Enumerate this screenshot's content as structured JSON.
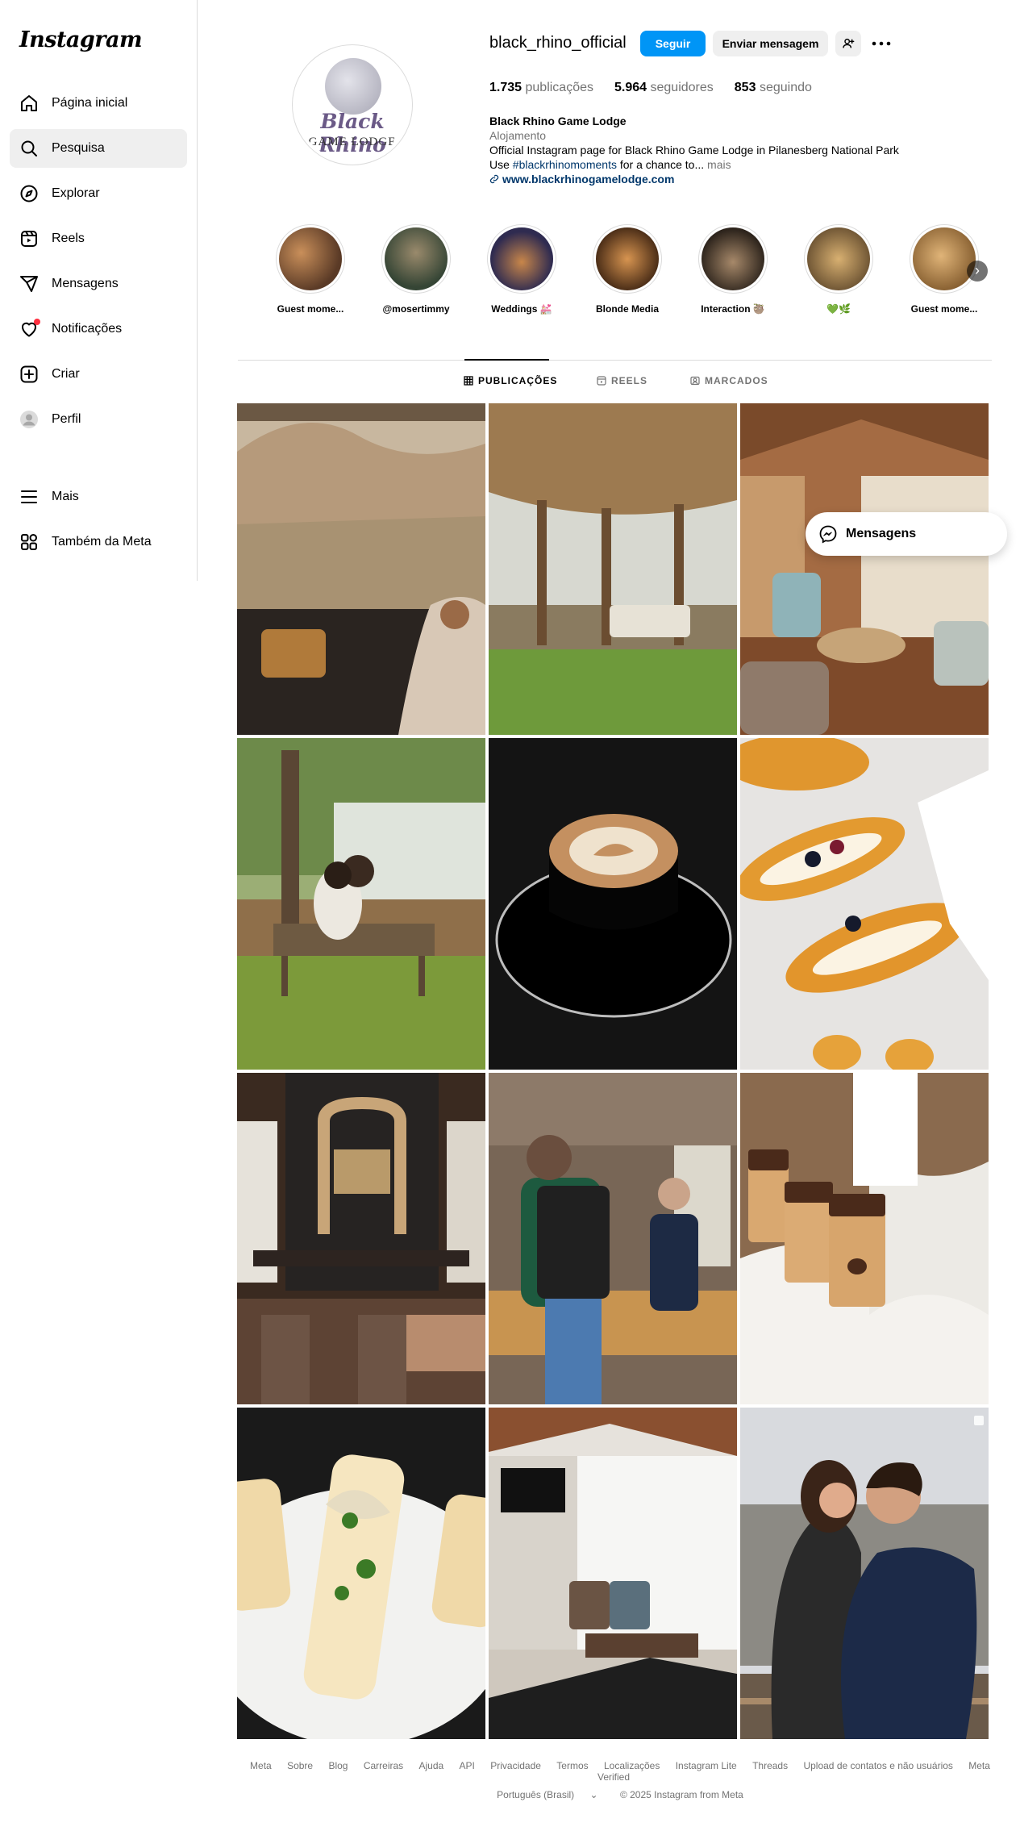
{
  "sidebar": {
    "logo": "Instagram",
    "items": [
      {
        "label": "Página inicial",
        "icon": "home-icon"
      },
      {
        "label": "Pesquisa",
        "icon": "search-icon"
      },
      {
        "label": "Explorar",
        "icon": "compass-icon"
      },
      {
        "label": "Reels",
        "icon": "reels-icon"
      },
      {
        "label": "Mensagens",
        "icon": "send-icon"
      },
      {
        "label": "Notificações",
        "icon": "heart-icon"
      },
      {
        "label": "Criar",
        "icon": "plus-square-icon"
      },
      {
        "label": "Perfil",
        "icon": "profile-avatar-icon"
      }
    ],
    "bottom": [
      {
        "label": "Mais",
        "icon": "menu-icon"
      },
      {
        "label": "Também da Meta",
        "icon": "meta-apps-icon"
      }
    ]
  },
  "profile": {
    "username": "black_rhino_official",
    "follow_label": "Seguir",
    "message_label": "Enviar mensagem",
    "avatar_text_1": "Black Rhino",
    "avatar_text_2": "GAME LODGE",
    "stats": {
      "posts_count": "1.735",
      "posts_label": "publicações",
      "followers_count": "5.964",
      "followers_label": "seguidores",
      "following_count": "853",
      "following_label": "seguindo"
    },
    "name": "Black Rhino Game Lodge",
    "category": "Alojamento",
    "bio_line1": "Official Instagram page for Black Rhino Game Lodge in Pilanesberg National Park",
    "bio_line2_prefix": "Use ",
    "bio_hashtag": "#blackrhinomoments",
    "bio_line2_suffix": " for a chance to...",
    "bio_more": " mais",
    "website": "www.blackrhinogamelodge.com"
  },
  "highlights": [
    {
      "label": "Guest mome...",
      "color": "#8a5a3a"
    },
    {
      "label": "@mosertimmy",
      "color": "#4a5a4a"
    },
    {
      "label": "Weddings 💒",
      "color": "#3d3a5c"
    },
    {
      "label": "Blonde Media",
      "color": "#6a4426"
    },
    {
      "label": "Interaction 🦥",
      "color": "#3b3127"
    },
    {
      "label": "💚🌿",
      "color": "#9b7a45"
    },
    {
      "label": "Guest mome...",
      "color": "#b58a55"
    }
  ],
  "tabs": {
    "posts": "PUBLICAÇÕES",
    "reels": "REELS",
    "tagged": "MARCADOS"
  },
  "floating_messages": "Mensagens",
  "footer": {
    "links": [
      "Meta",
      "Sobre",
      "Blog",
      "Carreiras",
      "Ajuda",
      "API",
      "Privacidade",
      "Termos",
      "Localizações",
      "Instagram Lite",
      "Threads",
      "Upload de contatos e não usuários",
      "Meta Verified"
    ],
    "language": "Português (Brasil)",
    "copyright": "© 2025 Instagram from Meta"
  }
}
